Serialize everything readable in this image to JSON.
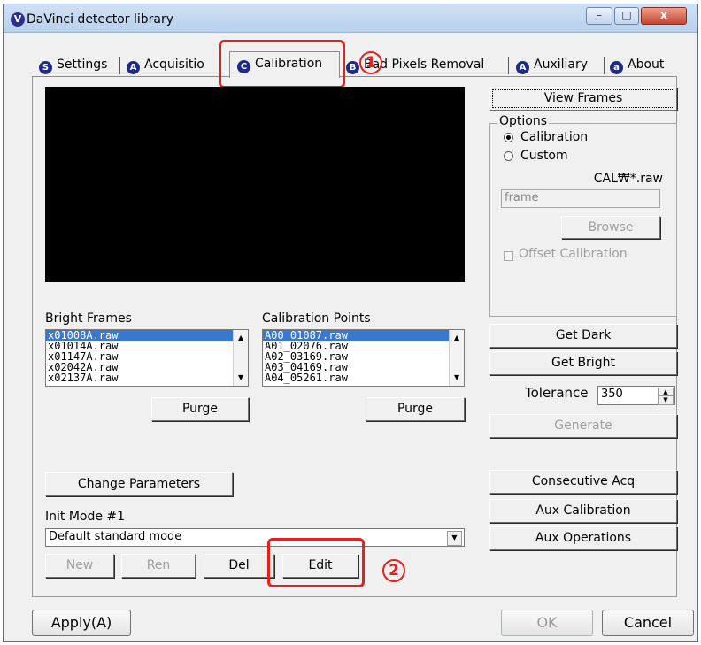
{
  "window": {
    "title": "DaVinci detector library",
    "minimize": "–",
    "maximize": "□",
    "close": "x"
  },
  "tabs": [
    {
      "label": "Settings",
      "icon": "S"
    },
    {
      "label": "Acquisitio",
      "icon": "A"
    },
    {
      "label": "Calibration",
      "icon": "C"
    },
    {
      "label": "Bad Pixels Removal",
      "icon": "B"
    },
    {
      "label": "Auxiliary",
      "icon": "A"
    },
    {
      "label": "About",
      "icon": "a"
    }
  ],
  "annotations": {
    "marker1": "1",
    "marker2": "2"
  },
  "bright_frames": {
    "label": "Bright Frames",
    "items": [
      "x01008A.raw",
      "x01014A.raw",
      "x01147A.raw",
      "x02042A.raw",
      "x02137A.raw"
    ],
    "purge": "Purge"
  },
  "calibration_points": {
    "label": "Calibration Points",
    "items": [
      "A00_01087.raw",
      "A01_02076.raw",
      "A02_03169.raw",
      "A03_04169.raw",
      "A04_05261.raw"
    ],
    "purge": "Purge"
  },
  "change_parameters": "Change Parameters",
  "init_mode": {
    "label": "Init Mode #1",
    "value": "Default standard mode",
    "buttons": {
      "new": "New",
      "ren": "Ren",
      "del": "Del",
      "edit": "Edit"
    }
  },
  "right": {
    "view_frames": "View Frames",
    "options_caption": "Options",
    "radio_calibration": "Calibration",
    "radio_custom": "Custom",
    "cal_pattern": "CAL₩*.raw",
    "frame_field": "frame",
    "browse": "Browse",
    "offset_calibration": "Offset Calibration",
    "get_dark": "Get Dark",
    "get_bright": "Get Bright",
    "tolerance_label": "Tolerance",
    "tolerance_value": "350",
    "generate": "Generate",
    "consecutive_acq": "Consecutive Acq",
    "aux_calibration": "Aux Calibration",
    "aux_operations": "Aux Operations"
  },
  "footer": {
    "apply": "Apply(A)",
    "ok": "OK",
    "cancel": "Cancel"
  },
  "colors": {
    "annotation_red": "#e8201c",
    "list_selection": "#3878d0",
    "tab_icon": "#1d2a8c"
  }
}
